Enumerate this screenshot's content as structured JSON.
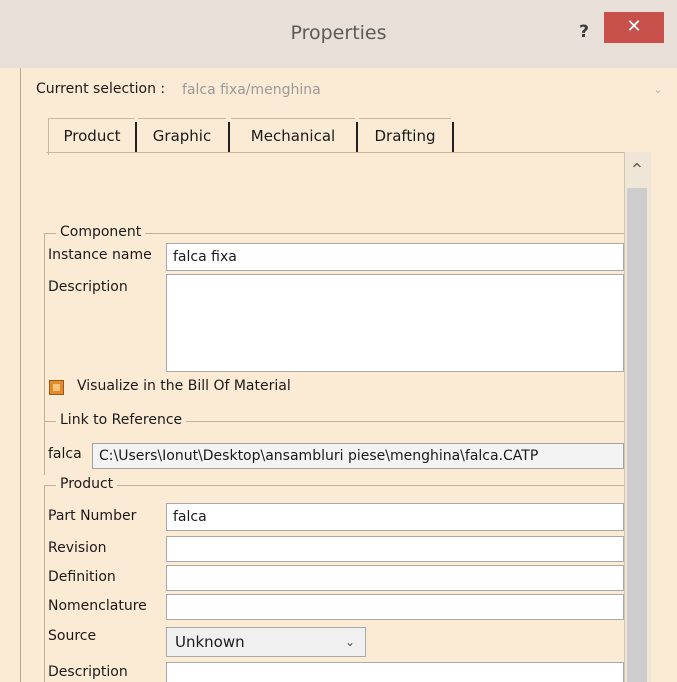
{
  "window": {
    "title": "Properties",
    "help_label": "?",
    "close_label": "✕"
  },
  "current_selection": {
    "label": "Current selection :",
    "value": "falca fixa/menghina",
    "chevron": "⌄"
  },
  "tabs": [
    {
      "label": "Product"
    },
    {
      "label": "Graphic"
    },
    {
      "label": "Mechanical"
    },
    {
      "label": "Drafting"
    }
  ],
  "scrollbar": {
    "up_arrow": "^"
  },
  "component": {
    "group_label": "Component",
    "instance_name_label": "Instance name",
    "instance_name_value": "falca fixa",
    "description_label": "Description",
    "description_value": "",
    "bom_checkbox_label": "Visualize in the Bill Of Material",
    "bom_checked": true
  },
  "link_to_reference": {
    "group_label": "Link to Reference",
    "name": "falca",
    "path": "C:\\Users\\Ionut\\Desktop\\ansambluri piese\\menghina\\falca.CATP"
  },
  "product": {
    "group_label": "Product",
    "part_number_label": "Part Number",
    "part_number_value": "falca",
    "revision_label": "Revision",
    "revision_value": "",
    "definition_label": "Definition",
    "definition_value": "",
    "nomenclature_label": "Nomenclature",
    "nomenclature_value": "",
    "source_label": "Source",
    "source_value": "Unknown",
    "description_label": "Description",
    "description_value": ""
  },
  "colors": {
    "background": "#fbebd4",
    "close_button": "#c7504b",
    "checkbox": "#e38a2a"
  }
}
